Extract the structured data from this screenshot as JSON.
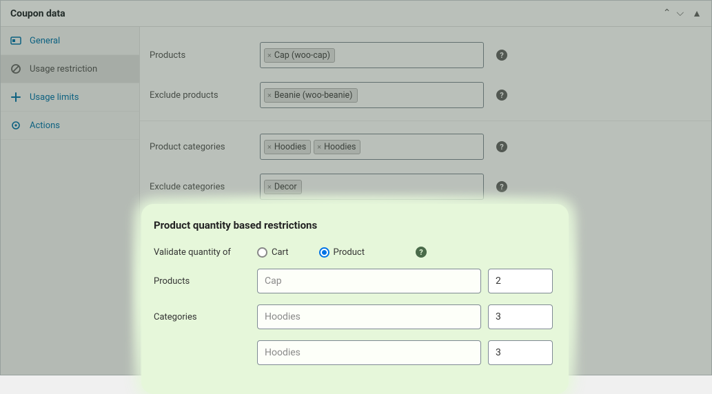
{
  "panel": {
    "title": "Coupon data"
  },
  "sidebar": {
    "items": [
      {
        "label": "General"
      },
      {
        "label": "Usage restriction"
      },
      {
        "label": "Usage limits"
      },
      {
        "label": "Actions"
      }
    ]
  },
  "form": {
    "products": {
      "label": "Products",
      "tags": [
        "Cap (woo-cap)"
      ]
    },
    "exclude_products": {
      "label": "Exclude products",
      "tags": [
        "Beanie (woo-beanie)"
      ]
    },
    "product_categories": {
      "label": "Product categories",
      "tags": [
        "Hoodies",
        "Hoodies"
      ]
    },
    "exclude_categories": {
      "label": "Exclude categories",
      "tags": [
        "Decor"
      ]
    }
  },
  "highlight": {
    "title": "Product quantity based restrictions",
    "validate_label": "Validate quantity of",
    "radio": {
      "cart": "Cart",
      "product": "Product",
      "selected": "product"
    },
    "rows": [
      {
        "label": "Products",
        "select": "Cap",
        "qty": "2"
      },
      {
        "label": "Categories",
        "select": "Hoodies",
        "qty": "3"
      },
      {
        "label": "",
        "select": "Hoodies",
        "qty": "3"
      }
    ]
  }
}
